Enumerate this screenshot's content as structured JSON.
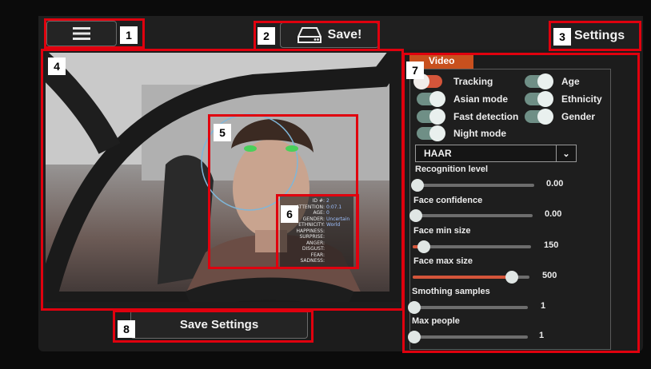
{
  "header": {
    "menu_icon": "hamburger-icon",
    "save_label": "Save!",
    "save_icon": "drive-icon",
    "settings_label": "Settings"
  },
  "annotations": [
    "1",
    "2",
    "3",
    "4",
    "5",
    "6",
    "7",
    "8"
  ],
  "video": {
    "face_info": [
      {
        "k": "ID #:",
        "v": "2"
      },
      {
        "k": "ATTENTION:",
        "v": "0:07.1"
      },
      {
        "k": "AGE:",
        "v": "0"
      },
      {
        "k": "GENDER:",
        "v": "Uncertain"
      },
      {
        "k": "ETHNICITY:",
        "v": "World"
      },
      {
        "k": "HAPPINESS:",
        "v": ""
      },
      {
        "k": "SURPRISE:",
        "v": ""
      },
      {
        "k": "ANGER:",
        "v": ""
      },
      {
        "k": "DISGUST:",
        "v": ""
      },
      {
        "k": "FEAR:",
        "v": ""
      },
      {
        "k": "SADNESS:",
        "v": ""
      }
    ]
  },
  "panel": {
    "tab_label": "Video",
    "toggles": [
      {
        "label": "Tracking",
        "on": false
      },
      {
        "label": "Age",
        "on": true
      },
      {
        "label": "Asian mode",
        "on": true
      },
      {
        "label": "Ethnicity",
        "on": true
      },
      {
        "label": "Fast detection",
        "on": true
      },
      {
        "label": "Gender",
        "on": true
      },
      {
        "label": "Night mode",
        "on": true
      }
    ],
    "detector": "HAAR",
    "sliders": [
      {
        "label": "Recognition level",
        "value": "0.00",
        "fraction": 0.0
      },
      {
        "label": "Face confidence",
        "value": "0.00",
        "fraction": 0.0
      },
      {
        "label": "Face min size",
        "value": "150",
        "fraction": 0.07
      },
      {
        "label": "Face max size",
        "value": "500",
        "fraction": 0.82
      },
      {
        "label": "Smothing samples",
        "value": "1",
        "fraction": 0.0
      },
      {
        "label": "Max people",
        "value": "1",
        "fraction": 0.0
      }
    ]
  },
  "footer": {
    "save_settings_label": "Save Settings"
  },
  "colors": {
    "accent": "#d4553a",
    "annotation": "#e0000e"
  }
}
